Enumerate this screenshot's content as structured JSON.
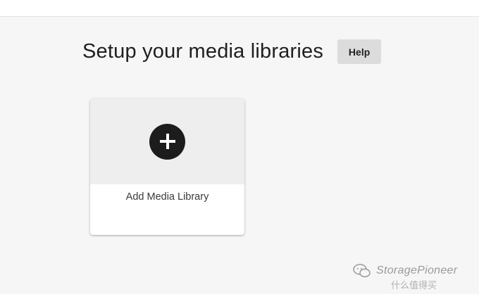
{
  "header": {
    "title": "Setup your media libraries",
    "help_label": "Help"
  },
  "library_card": {
    "label": "Add Media Library",
    "icon": "plus-circle-icon"
  },
  "watermark": {
    "text": "StoragePioneer",
    "sub_text": "什么值得买"
  },
  "colors": {
    "background": "#f6f6f6",
    "card_image_bg": "#eeeeee",
    "plus_circle": "#1c1c1c",
    "help_button_bg": "#dcdcdc"
  }
}
